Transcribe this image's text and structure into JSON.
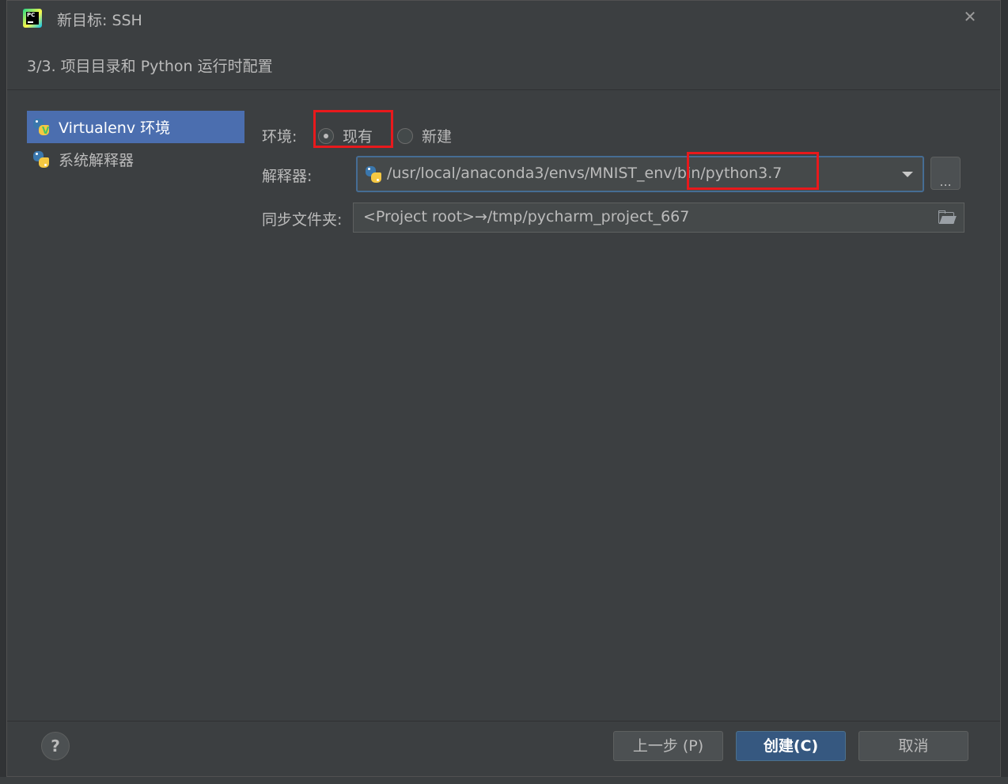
{
  "dialog": {
    "title": "新目标: SSH",
    "close_glyph": "✕",
    "step_text": "3/3. 项目目录和 Python 运行时配置"
  },
  "sidebar": {
    "items": [
      {
        "label": "Virtualenv 环境",
        "icon": "python-venv-icon",
        "selected": true
      },
      {
        "label": "系统解释器",
        "icon": "python-icon",
        "selected": false
      }
    ]
  },
  "form": {
    "environment_label": "环境:",
    "radio_existing": "现有",
    "radio_new": "新建",
    "selected_radio": "现有",
    "interpreter_label": "解释器:",
    "interpreter_value": "/usr/local/anaconda3/envs/MNIST_env/bin/python3.7",
    "browse_label": "...",
    "sync_label": "同步文件夹:",
    "sync_value": "<Project root>→/tmp/pycharm_project_667"
  },
  "footer": {
    "help_label": "?",
    "prev_label": "上一步 (P)",
    "create_label": "创建(C)",
    "cancel_label": "取消"
  },
  "colors": {
    "dialog_bg": "#3c3f41",
    "selection": "#4b6eaf",
    "primary_button": "#365880",
    "annotation_red": "#e8191c",
    "focus_border": "#466d94"
  }
}
